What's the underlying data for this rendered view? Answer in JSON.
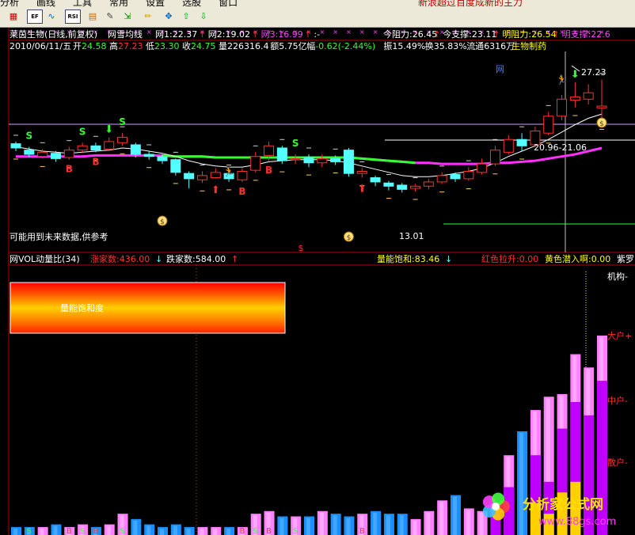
{
  "toolbar": {
    "menu": [
      "分析",
      "画线",
      "工具",
      "常用",
      "设置",
      "选股",
      "窗口"
    ],
    "promo": "新浪超过百度成新的主力",
    "buttons": [
      {
        "name": "chart-type-icon",
        "label": "▦"
      },
      {
        "name": "ex-data-icon",
        "label": "EF"
      },
      {
        "name": "indicator-icon",
        "label": "∿"
      },
      {
        "name": "rsi-icon",
        "label": "RSI"
      },
      {
        "name": "tiles-icon",
        "label": "▤"
      },
      {
        "name": "wrench-icon",
        "label": "✎"
      },
      {
        "name": "import-icon",
        "label": "⇲"
      },
      {
        "name": "pencil-icon",
        "label": "✏"
      },
      {
        "name": "move-icon",
        "label": "✥"
      },
      {
        "name": "up-arrow-icon",
        "label": "⇧"
      },
      {
        "name": "down-arrow-icon",
        "label": "⇩"
      }
    ]
  },
  "main_header": {
    "title": "莱茵生物(日线,前复权)",
    "indicator": "网雪均线",
    "items": [
      {
        "label": "网1:22.37",
        "arrow": "↑",
        "color": "#ffffff",
        "arrow_color": "#ff3030"
      },
      {
        "label": "网2:19.02",
        "arrow": "↑",
        "color": "#ffffff",
        "arrow_color": "#ff3030"
      },
      {
        "label": "网3:16.99",
        "arrow": "↑",
        "color": "#ff40ff",
        "arrow_color": "#ff3030"
      },
      {
        "label": ":-",
        "arrow": "",
        "color": "#ffffff",
        "arrow_color": "#ffffff"
      }
    ],
    "right": [
      {
        "label": "今阻力:26.45",
        "arrow": "↑",
        "color": "#ffffff"
      },
      {
        "label": "今支撑:23.11",
        "arrow": "↑",
        "color": "#ffffff"
      },
      {
        "label": "明阻力:26.54",
        "arrow": "↑",
        "color": "#ffff00"
      },
      {
        "label": "明支撑:22.6",
        "arrow": "",
        "color": "#ff40ff"
      }
    ]
  },
  "quote": {
    "date": "2010/06/11/五",
    "open_label": "开",
    "open": "24.58",
    "high_label": "高",
    "high": "27.23",
    "low_label": "低",
    "low": "23.30",
    "close_label": "收",
    "close": "24.75",
    "volume_label": "量",
    "volume": "226316.4",
    "amount_label": "额",
    "amount": "5.75亿",
    "change_label": "幅",
    "change": "-0.62(-2.44%)",
    "amplitude_label": "振",
    "amplitude": "15.49%",
    "turnover_label": "换",
    "turnover": "35.83%",
    "float_label": "流通",
    "float": "6316万",
    "sector": "生物制药"
  },
  "annotations": {
    "peak_price": "27.23",
    "range_label": "20.96-21.06",
    "low_price": "13.01",
    "disclaimer": "可能用到未来数据,供参考",
    "net_marker": "网"
  },
  "sub_header": {
    "title": "网VOL动量比(34)",
    "up_label": "涨家数:436.00",
    "up_arrow": "↓",
    "down_label": "跌家数:584.00",
    "down_arrow": "↑",
    "saturation": "量能饱和:83.46",
    "saturation_arrow": "↓",
    "red_label": "红色拉升:0.00",
    "yellow_label": "黄色潜入啊:0.00",
    "purple_label": "紫罗"
  },
  "legend_box": {
    "text": "量能饱和度"
  },
  "side_labels": [
    "机构-",
    "大户+",
    "中户-",
    "散户-"
  ],
  "watermark": {
    "site": "分析家公式网",
    "url": "www.88gs.com"
  },
  "colors": {
    "up": "#ff3030",
    "down": "#54ffff",
    "ma_magenta": "#ff30ff",
    "ma_green": "#30ff30",
    "blue_bar": "#1a8fff",
    "pink_bar": "#ff80ff",
    "purple_bar": "#c000ff",
    "yellow_bar": "#ffd000"
  },
  "chart_data": [
    {
      "type": "candlestick",
      "title": "莱茵生物(日线,前复权)",
      "ylim": [
        12,
        29
      ],
      "candles": [
        {
          "o": 21.2,
          "c": 20.8,
          "h": 21.4,
          "l": 20.5
        },
        {
          "o": 20.6,
          "c": 20.2,
          "h": 20.9,
          "l": 19.9
        },
        {
          "o": 20.0,
          "c": 20.4,
          "h": 20.7,
          "l": 19.8
        },
        {
          "o": 20.3,
          "c": 19.8,
          "h": 20.5,
          "l": 19.5
        },
        {
          "o": 19.9,
          "c": 20.6,
          "h": 20.9,
          "l": 19.7
        },
        {
          "o": 20.6,
          "c": 21.0,
          "h": 21.3,
          "l": 20.3
        },
        {
          "o": 21.0,
          "c": 20.6,
          "h": 21.3,
          "l": 20.4
        },
        {
          "o": 20.7,
          "c": 21.4,
          "h": 21.8,
          "l": 20.5
        },
        {
          "o": 21.3,
          "c": 21.8,
          "h": 22.2,
          "l": 21.0
        },
        {
          "o": 21.1,
          "c": 20.2,
          "h": 21.3,
          "l": 19.9
        },
        {
          "o": 20.2,
          "c": 20.0,
          "h": 20.5,
          "l": 19.7
        },
        {
          "o": 20.0,
          "c": 19.6,
          "h": 20.2,
          "l": 19.3
        },
        {
          "o": 19.7,
          "c": 18.5,
          "h": 19.8,
          "l": 18.2
        },
        {
          "o": 18.4,
          "c": 17.9,
          "h": 18.6,
          "l": 17.0
        },
        {
          "o": 17.8,
          "c": 18.2,
          "h": 18.6,
          "l": 17.5
        },
        {
          "o": 18.0,
          "c": 18.5,
          "h": 18.9,
          "l": 17.9
        },
        {
          "o": 18.4,
          "c": 17.9,
          "h": 18.6,
          "l": 17.6
        },
        {
          "o": 17.8,
          "c": 18.6,
          "h": 18.9,
          "l": 17.6
        },
        {
          "o": 18.7,
          "c": 20.0,
          "h": 20.4,
          "l": 18.5
        },
        {
          "o": 20.1,
          "c": 21.0,
          "h": 21.4,
          "l": 19.6
        },
        {
          "o": 20.8,
          "c": 19.6,
          "h": 21.0,
          "l": 19.3
        },
        {
          "o": 19.7,
          "c": 19.8,
          "h": 20.2,
          "l": 19.3
        },
        {
          "o": 19.9,
          "c": 19.4,
          "h": 20.2,
          "l": 19.0
        },
        {
          "o": 19.4,
          "c": 19.8,
          "h": 20.2,
          "l": 19.0
        },
        {
          "o": 19.8,
          "c": 19.5,
          "h": 20.1,
          "l": 19.2
        },
        {
          "o": 20.6,
          "c": 18.4,
          "h": 20.8,
          "l": 18.1
        },
        {
          "o": 18.4,
          "c": 18.6,
          "h": 18.9,
          "l": 18.0
        },
        {
          "o": 18.0,
          "c": 17.6,
          "h": 18.2,
          "l": 17.2
        },
        {
          "o": 17.5,
          "c": 17.2,
          "h": 17.7,
          "l": 16.8
        },
        {
          "o": 17.3,
          "c": 16.9,
          "h": 17.5,
          "l": 16.6
        },
        {
          "o": 17.0,
          "c": 17.2,
          "h": 17.4,
          "l": 16.7
        },
        {
          "o": 17.2,
          "c": 17.6,
          "h": 17.9,
          "l": 16.9
        },
        {
          "o": 17.6,
          "c": 18.2,
          "h": 18.5,
          "l": 17.4
        },
        {
          "o": 18.3,
          "c": 17.9,
          "h": 18.5,
          "l": 17.6
        },
        {
          "o": 17.9,
          "c": 18.6,
          "h": 19.0,
          "l": 17.7
        },
        {
          "o": 18.5,
          "c": 19.3,
          "h": 19.8,
          "l": 18.3
        },
        {
          "o": 19.3,
          "c": 20.6,
          "h": 21.0,
          "l": 19.1
        },
        {
          "o": 20.4,
          "c": 21.6,
          "h": 22.0,
          "l": 20.2
        },
        {
          "o": 21.6,
          "c": 21.0,
          "h": 22.2,
          "l": 20.5
        },
        {
          "o": 21.1,
          "c": 22.4,
          "h": 22.8,
          "l": 20.9
        },
        {
          "o": 22.2,
          "c": 23.8,
          "h": 24.2,
          "l": 22.0
        },
        {
          "o": 23.8,
          "c": 25.4,
          "h": 25.8,
          "l": 23.4
        },
        {
          "o": 25.3,
          "c": 25.6,
          "h": 27.0,
          "l": 24.6
        },
        {
          "o": 25.4,
          "c": 26.0,
          "h": 26.8,
          "l": 24.9
        },
        {
          "o": 24.58,
          "c": 24.75,
          "h": 27.23,
          "l": 23.3
        }
      ],
      "ma_white": [
        20.9,
        20.7,
        20.5,
        20.4,
        20.3,
        20.4,
        20.5,
        20.6,
        20.8,
        20.7,
        20.5,
        20.3,
        20.0,
        19.6,
        19.3,
        19.1,
        19.0,
        19.0,
        19.2,
        19.5,
        19.6,
        19.7,
        19.7,
        19.7,
        19.6,
        19.4,
        19.1,
        18.8,
        18.5,
        18.2,
        18.1,
        18.1,
        18.2,
        18.4,
        18.6,
        18.9,
        19.4,
        20.0,
        20.5,
        21.0,
        21.6,
        22.3,
        23.0,
        23.6,
        24.0
      ],
      "ma_magenta": [
        20.0,
        20.0,
        20.0,
        20.0,
        20.0,
        20.0,
        20.1,
        20.1,
        20.1,
        20.1,
        20.1,
        20.1,
        20.0,
        20.0,
        20.0,
        19.9,
        19.9,
        19.9,
        19.9,
        19.9,
        19.9,
        19.9,
        19.9,
        19.9,
        19.9,
        19.9,
        19.8,
        19.7,
        19.6,
        19.5,
        19.4,
        19.4,
        19.3,
        19.3,
        19.3,
        19.3,
        19.4,
        19.4,
        19.5,
        19.6,
        19.8,
        20.0,
        20.2,
        20.5,
        20.8
      ],
      "ma_green_range": [
        11,
        30
      ],
      "support_line": 24.0,
      "range_line": 22.0,
      "low_line": 17.0
    },
    {
      "type": "bar",
      "title": "网VOL动量比(34)",
      "ylim": [
        0,
        100
      ],
      "series": [
        {
          "name": "涨家数",
          "values": [
            3,
            3,
            3,
            4,
            3,
            4,
            3,
            4,
            8,
            6,
            4,
            3,
            4,
            3,
            3,
            3,
            3,
            3,
            8,
            9,
            7,
            7,
            7,
            9,
            8,
            7,
            8,
            9,
            8,
            8,
            6,
            9,
            13,
            15,
            10,
            9,
            12,
            30,
            39,
            47,
            52,
            53,
            68,
            63,
            75
          ]
        },
        {
          "name": "跌家数",
          "values": [
            3,
            3,
            3,
            3,
            3,
            3,
            3,
            3,
            7,
            5,
            3,
            3,
            3,
            3,
            3,
            3,
            3,
            3,
            6,
            7,
            6,
            6,
            6,
            8,
            7,
            6,
            7,
            8,
            7,
            7,
            6,
            8,
            10,
            12,
            8,
            8,
            9,
            18,
            22,
            30,
            20,
            40,
            50,
            45,
            58
          ]
        }
      ]
    }
  ]
}
